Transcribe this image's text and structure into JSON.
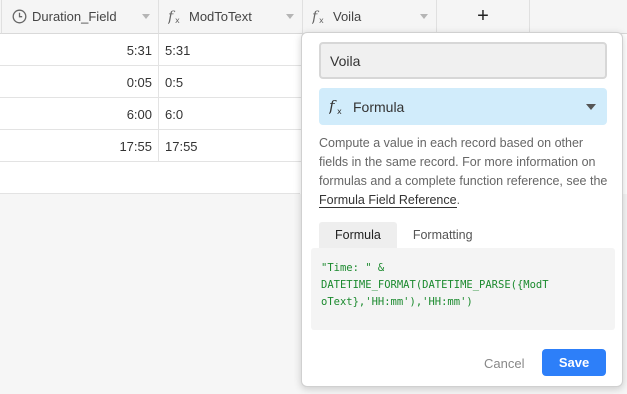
{
  "columns": [
    {
      "name": "Duration_Field",
      "icon": "clock-icon"
    },
    {
      "name": "ModToText",
      "icon": "formula-icon"
    },
    {
      "name": "Voila",
      "icon": "formula-icon"
    }
  ],
  "add_column_label": "+",
  "rows": [
    {
      "duration": "5:31",
      "modtotext": "5:31"
    },
    {
      "duration": "0:05",
      "modtotext": "0:5"
    },
    {
      "duration": "6:00",
      "modtotext": "6:0"
    },
    {
      "duration": "17:55",
      "modtotext": "17:55"
    }
  ],
  "popover": {
    "field_name_value": "Voila",
    "field_type_label": "Formula",
    "description_text": "Compute a value in each record based on other fields in the same record. For more information on formulas and a complete function reference, see the ",
    "reference_link_text": "Formula Field Reference",
    "description_end": ".",
    "tabs": [
      {
        "label": "Formula",
        "active": true
      },
      {
        "label": "Formatting",
        "active": false
      }
    ],
    "formula_lines": [
      "\"Time: \" &",
      "DATETIME_FORMAT(DATETIME_PARSE({ModT",
      "oText},'HH:mm'),'HH:mm')"
    ],
    "cancel_label": "Cancel",
    "save_label": "Save"
  },
  "colors": {
    "accent": "#2d7ff9",
    "type_selector_bg": "#d1ecfb",
    "formula_text": "#1b8a2e"
  }
}
